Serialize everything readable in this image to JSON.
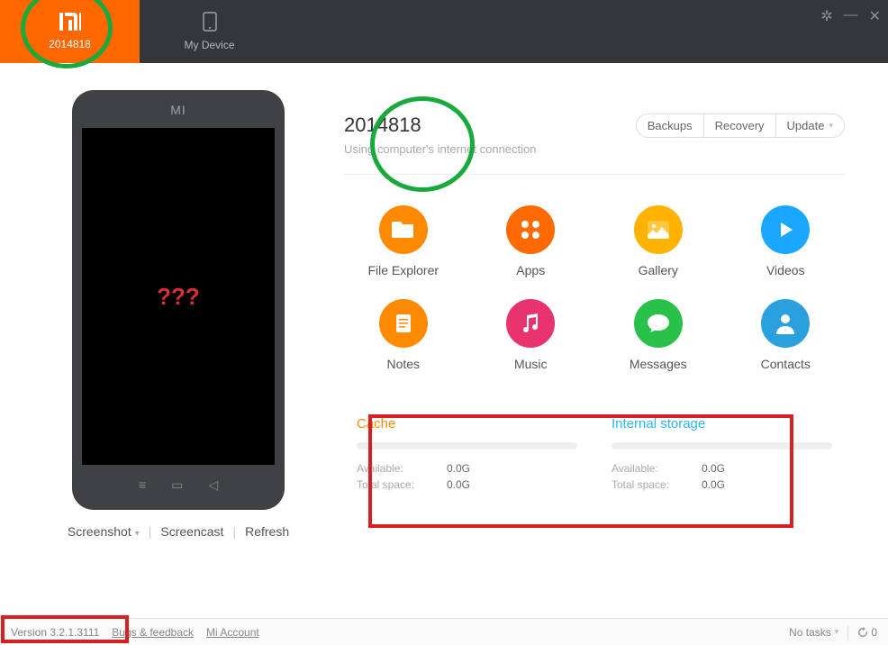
{
  "header": {
    "tabs": [
      {
        "icon": "mi-logo",
        "label": "2014818"
      },
      {
        "icon": "device",
        "label": "My Device"
      }
    ]
  },
  "phone": {
    "brand": "MI",
    "screen_text": "???",
    "actions": {
      "screenshot": "Screenshot",
      "screencast": "Screencast",
      "refresh": "Refresh"
    }
  },
  "device": {
    "name": "2014818",
    "subtitle": "Using computer's internet connection",
    "buttons": {
      "backups": "Backups",
      "recovery": "Recovery",
      "update": "Update"
    }
  },
  "features": [
    {
      "name": "file-explorer",
      "label": "File Explorer",
      "color": "#ff8a00"
    },
    {
      "name": "apps",
      "label": "Apps",
      "color": "#ff6a00"
    },
    {
      "name": "gallery",
      "label": "Gallery",
      "color": "#ffb300"
    },
    {
      "name": "videos",
      "label": "Videos",
      "color": "#1aa7ff"
    },
    {
      "name": "notes",
      "label": "Notes",
      "color": "#ff8a00"
    },
    {
      "name": "music",
      "label": "Music",
      "color": "#e8336e"
    },
    {
      "name": "messages",
      "label": "Messages",
      "color": "#2ac14a"
    },
    {
      "name": "contacts",
      "label": "Contacts",
      "color": "#2aa0df"
    }
  ],
  "storage": {
    "cache": {
      "title": "Cache",
      "available_label": "Available:",
      "available": "0.0G",
      "total_label": "Total space:",
      "total": "0.0G"
    },
    "internal": {
      "title": "Internal storage",
      "available_label": "Available:",
      "available": "0.0G",
      "total_label": "Total space:",
      "total": "0.0G"
    }
  },
  "footer": {
    "version": "Version 3.2.1.3111",
    "bugs": "Bugs & feedback",
    "account": "Mi Account",
    "tasks": "No tasks",
    "reload_count": "0"
  }
}
